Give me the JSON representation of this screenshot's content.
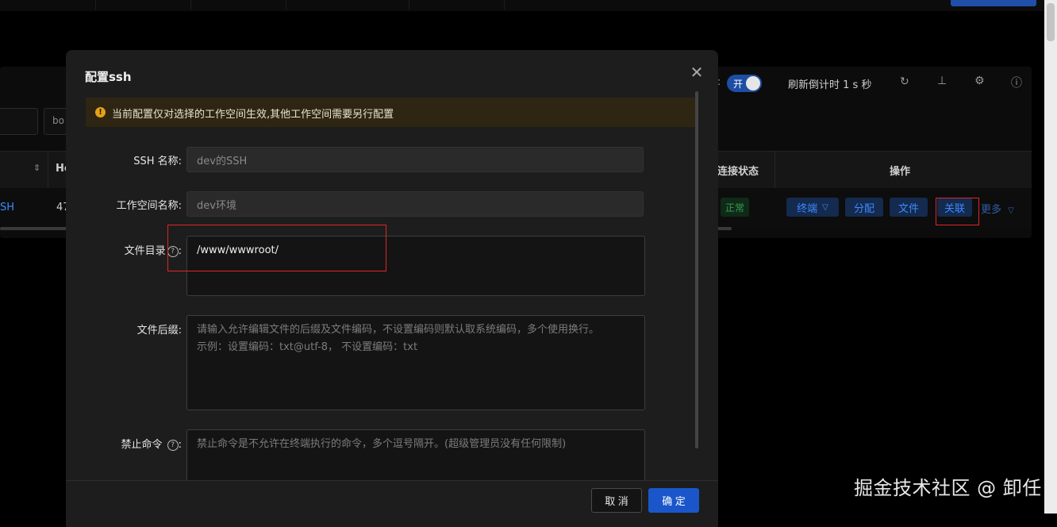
{
  "background": {
    "countdown_label": "刷新倒计时 1 s 秒",
    "toggle_label": "开",
    "colon": ":",
    "col_connection_status": "连接状态",
    "col_actions": "操作",
    "col_he": "He",
    "cell_ssh": "SH",
    "cell_num": "47",
    "cell_partial": "bo",
    "status_normal": "正常",
    "btn_terminal": "终端",
    "btn_assign": "分配",
    "btn_file": "文件",
    "btn_link": "关联",
    "btn_more": "更多"
  },
  "modal": {
    "title": "配置ssh",
    "alert_text": "当前配置仅对选择的工作空间生效,其他工作空间需要另行配置",
    "fields": {
      "ssh_name": {
        "label": "SSH 名称:",
        "value": "dev的SSH"
      },
      "workspace_name": {
        "label": "工作空间名称:",
        "value": "dev环境"
      },
      "file_dir": {
        "label": "文件目录",
        "label_suffix": ":",
        "value": "/www/wwwroot/"
      },
      "file_suffix": {
        "label": "文件后缀:",
        "placeholder_line1": "请输入允许编辑文件的后缀及文件编码，不设置编码则默认取系统编码，多个使用换行。",
        "placeholder_line2": "示例：设置编码：txt@utf-8， 不设置编码：txt"
      },
      "forbidden_cmd": {
        "label": "禁止命令",
        "label_suffix": ":",
        "placeholder": "禁止命令是不允许在终端执行的命令，多个逗号隔开。(超级管理员没有任何限制)"
      }
    },
    "footer": {
      "cancel_label": "取 消",
      "ok_label": "确 定"
    }
  },
  "watermark": "掘金技术社区 @ 卸任"
}
